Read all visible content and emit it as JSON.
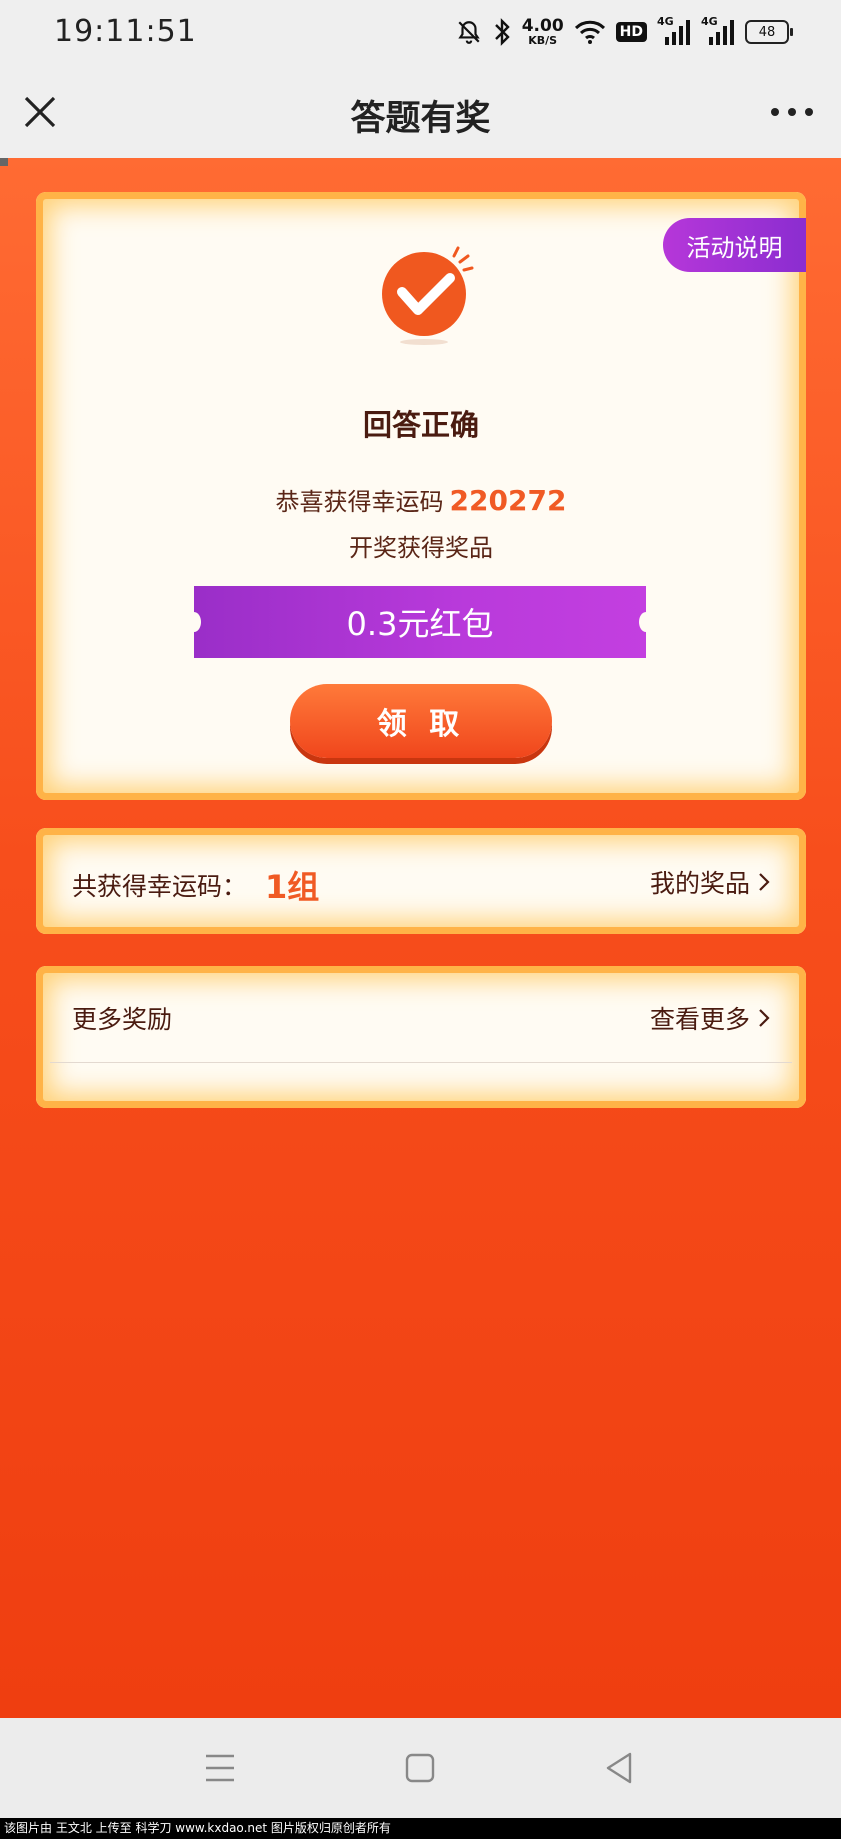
{
  "status_bar": {
    "time": "19:11:51",
    "net_speed_value": "4.00",
    "net_speed_unit": "KB/S",
    "hd_label": "HD",
    "signal1_label": "4G",
    "signal2_label": "4G",
    "battery": "48"
  },
  "nav": {
    "title": "答题有奖"
  },
  "main_card": {
    "activity_label": "活动说明",
    "result_title": "回答正确",
    "congrats_text": "恭喜获得幸运码",
    "lucky_code": "220272",
    "draw_text": "开奖获得奖品",
    "prize_label": "0.3元红包",
    "claim_label": "领 取"
  },
  "lucky_card": {
    "label": "共获得幸运码：",
    "count": "1组",
    "link_label": "我的奖品"
  },
  "more_card": {
    "label": "更多奖励",
    "link_label": "查看更多"
  },
  "watermark": "该图片由 王文北 上传至 科学刀 www.kxdao.net 图片版权归原创者所有",
  "colors": {
    "accent": "#f05a24",
    "purple": "#a933d2",
    "card_border": "#ffb347"
  }
}
